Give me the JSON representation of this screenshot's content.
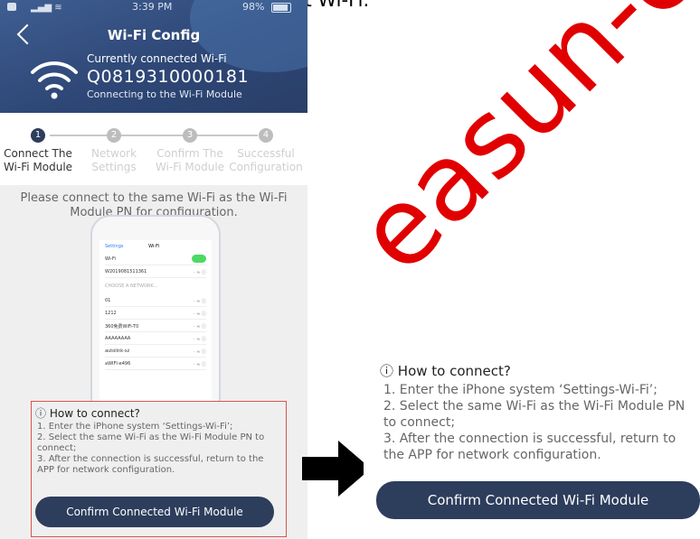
{
  "intro_text": "and you may follow it to connect Wi-Fi.",
  "status_bar": {
    "time": "3:39 PM",
    "battery": "98%"
  },
  "header": {
    "back_icon": "chevron-left-icon",
    "title": "Wi-Fi Config",
    "wifi_icon": "wifi-icon",
    "connected_label": "Currently connected Wi-Fi",
    "connected_ssid": "Q0819310000181",
    "connection_status": "Connecting to the Wi-Fi Module"
  },
  "steps": [
    {
      "number": "1",
      "label": "Connect The Wi-Fi Module",
      "active": true
    },
    {
      "number": "2",
      "label": "Network Settings",
      "active": false
    },
    {
      "number": "3",
      "label": "Confirm The Wi-Fi Module",
      "active": false
    },
    {
      "number": "4",
      "label": "Successful Configuration",
      "active": false
    }
  ],
  "instruction": "Please connect to the same Wi-Fi as the Wi-Fi Module PN for configuration.",
  "phone_mockup": {
    "back_label": "Settings",
    "title": "Wi-Fi",
    "wifi_label": "Wi-Fi",
    "connected_network": "W2019081511361",
    "section_label": "CHOOSE A NETWORK...",
    "networks": [
      "01",
      "1212",
      "360免费WiFi-T0",
      "AAAAAAAA",
      "autolink-sz",
      "aWIFI-e496"
    ]
  },
  "how_to": {
    "icon": "info-circle-icon",
    "title": "How to connect?",
    "steps": [
      "1. Enter the iPhone system ‘Settings-Wi-Fi’;",
      "2. Select the same Wi-Fi as the Wi-Fi Module PN to connect;",
      "3. After the connection is successful, return to the APP for network configuration."
    ]
  },
  "confirm_button": "Confirm Connected Wi-Fi Module",
  "arrow_icon": "right-arrow-icon",
  "watermark": "easun-ener",
  "colors": {
    "header": "#2e4776",
    "button": "#2d3d5c",
    "highlight_border": "#d9534f",
    "watermark": "#e10000"
  }
}
